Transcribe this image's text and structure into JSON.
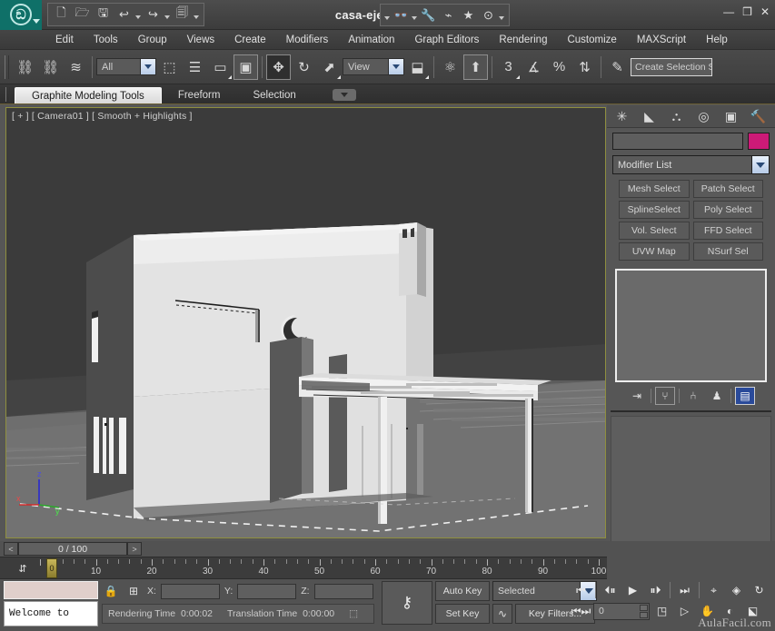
{
  "title_bar": {
    "document_title": "casa-ejemplo.max",
    "logo_name": "3ds-max-logo",
    "quick_access": [
      {
        "name": "new-file",
        "glyph": "🗋"
      },
      {
        "name": "open-file",
        "glyph": "🗁"
      },
      {
        "name": "save-file",
        "glyph": "🖫"
      },
      {
        "name": "undo",
        "glyph": "↩"
      },
      {
        "name": "redo",
        "glyph": "↪"
      },
      {
        "name": "project-folder",
        "glyph": "🗐"
      }
    ],
    "quick_access_right": [
      {
        "name": "search-binoculars",
        "glyph": "👓"
      },
      {
        "name": "wrench-tools",
        "glyph": "🔧"
      },
      {
        "name": "render-setup",
        "glyph": "⌁"
      },
      {
        "name": "favorites-star",
        "glyph": "★"
      },
      {
        "name": "help",
        "glyph": "?"
      }
    ],
    "window_controls": [
      "—",
      "□",
      "✕"
    ]
  },
  "menu": {
    "items": [
      "Edit",
      "Tools",
      "Group",
      "Views",
      "Create",
      "Modifiers",
      "Animation",
      "Graph Editors",
      "Rendering",
      "Customize",
      "MAXScript",
      "Help"
    ]
  },
  "main_toolbar": {
    "filter_value": "All",
    "reference_coord_value": "View",
    "selection_set_placeholder": "Create Selection S",
    "items": [
      {
        "name": "select-and-link",
        "glyph": "⛓"
      },
      {
        "name": "unlink-selection",
        "glyph": "⛓"
      },
      {
        "name": "bind-to-space-warp",
        "glyph": "≋"
      },
      {
        "name": "select-object",
        "glyph": "⬚"
      },
      {
        "name": "select-by-name",
        "glyph": "☰"
      },
      {
        "name": "rectangular-selection-region",
        "glyph": "▭"
      },
      {
        "name": "window-crossing",
        "glyph": "▣"
      },
      {
        "name": "select-and-move",
        "glyph": "✥"
      },
      {
        "name": "select-and-rotate",
        "glyph": "↻"
      },
      {
        "name": "select-and-scale",
        "glyph": "⬈"
      },
      {
        "name": "use-pivot-point-center",
        "glyph": "⬓"
      },
      {
        "name": "select-and-manipulate",
        "glyph": "⚛"
      },
      {
        "name": "snaps-toggle",
        "glyph": "⬆"
      },
      {
        "name": "snap-3d",
        "glyph": "3"
      },
      {
        "name": "angle-snap-toggle",
        "glyph": "∡"
      },
      {
        "name": "percent-snap-toggle",
        "glyph": "%"
      },
      {
        "name": "spinner-snap-toggle",
        "glyph": "⇅"
      },
      {
        "name": "edit-named-selection-sets",
        "glyph": "✎"
      }
    ]
  },
  "ribbon": {
    "tabs": [
      {
        "label": "Graphite Modeling Tools",
        "active": true
      },
      {
        "label": "Freeform",
        "active": false
      },
      {
        "label": "Selection",
        "active": false
      }
    ]
  },
  "viewport": {
    "label": "[ + ] [ Camera01 ] [ Smooth + Highlights ]",
    "axis": {
      "x": "x",
      "y": "y",
      "z": "z",
      "x_color": "#cc2222",
      "y_color": "#22aa22",
      "z_color": "#2222cc"
    },
    "scene_description": "white architectural house model with pergola"
  },
  "command_panel": {
    "tab_icons": [
      {
        "name": "create-tab",
        "glyph": "✳"
      },
      {
        "name": "modify-tab",
        "glyph": "◣"
      },
      {
        "name": "hierarchy-tab",
        "glyph": "⛬"
      },
      {
        "name": "motion-tab",
        "glyph": "◎"
      },
      {
        "name": "display-tab",
        "glyph": "▣"
      },
      {
        "name": "utilities-tab",
        "glyph": "🔨"
      }
    ],
    "object_name": "",
    "color_swatch": "#CC1A77",
    "modifier_list_label": "Modifier List",
    "modifier_buttons": [
      "Mesh Select",
      "Patch Select",
      "SplineSelect",
      "Poly Select",
      "Vol. Select",
      "FFD Select",
      "UVW Map",
      "NSurf Sel"
    ],
    "stack_tools": [
      {
        "name": "pin-stack-icon",
        "glyph": "⇥"
      },
      {
        "name": "show-end-result-icon",
        "glyph": "⑂"
      },
      {
        "name": "make-unique-icon",
        "glyph": "⑃"
      },
      {
        "name": "remove-modifier-icon",
        "glyph": "♟"
      },
      {
        "name": "configure-modifier-sets-icon",
        "glyph": "▤"
      }
    ]
  },
  "bottom": {
    "frame_nav": {
      "prev": "<",
      "next": ">",
      "value": "0 / 100"
    },
    "track_ruler": {
      "min": 0,
      "max": 100,
      "labels": [
        10,
        20,
        30,
        40,
        50,
        60,
        70,
        80,
        90,
        100
      ],
      "slider_label": "0"
    },
    "maxscript_listener_text": "Welcome to",
    "coordinates": {
      "x_label": "X:",
      "x_value": "",
      "y_label": "Y:",
      "y_value": "",
      "z_label": "Z:",
      "z_value": ""
    },
    "status": {
      "rendering_time_label": "Rendering Time",
      "rendering_time_value": "0:00:02",
      "translation_time_label": "Translation Time",
      "translation_time_value": "0:00:00"
    },
    "animation": {
      "key_mode_icon": "key-icon",
      "auto_key_label": "Auto Key",
      "set_key_label": "Set Key",
      "filter_value": "Selected",
      "key_filters_label": "Key Filters...",
      "current_frame": "0"
    },
    "playback_controls": [
      {
        "name": "go-to-start",
        "glyph": "⏮"
      },
      {
        "name": "previous-frame",
        "glyph": "◀|"
      },
      {
        "name": "play-animation",
        "glyph": "▶"
      },
      {
        "name": "next-frame",
        "glyph": "|▶"
      },
      {
        "name": "go-to-end",
        "glyph": "⏭"
      }
    ],
    "viewport_nav": [
      {
        "name": "zoom-icon",
        "glyph": "⌖"
      },
      {
        "name": "zoom-extents-icon",
        "glyph": "◈"
      },
      {
        "name": "field-of-view-icon",
        "glyph": "↻"
      },
      {
        "name": "zoom-all-icon",
        "glyph": "▤"
      },
      {
        "name": "pan-view-icon",
        "glyph": "✋"
      },
      {
        "name": "orbit-icon",
        "glyph": "◐"
      },
      {
        "name": "maximize-viewport-toggle-icon",
        "glyph": "⬕"
      },
      {
        "name": "arc-rotate-icon",
        "glyph": "▷"
      },
      {
        "name": "time-configuration-icon",
        "glyph": "◳"
      }
    ],
    "watermark": "AulaFacil.com"
  }
}
